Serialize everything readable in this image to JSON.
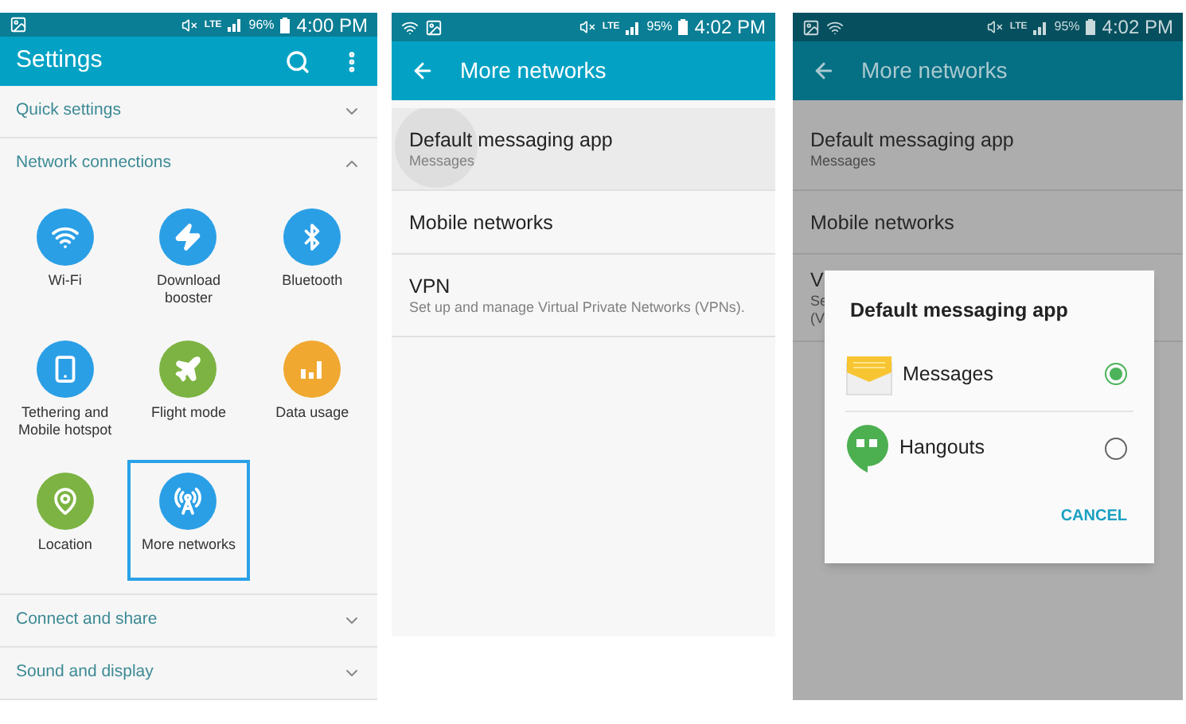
{
  "screens": [
    {
      "kind": "settings",
      "status_bar": {
        "icons": [
          {
            "kind": "image"
          }
        ],
        "network": "LTE",
        "battery": "96%",
        "time": "4:00 PM"
      },
      "title": "Settings",
      "sections": [
        {
          "label": "Quick settings",
          "expanded": false
        },
        {
          "label": "Network connections",
          "expanded": true,
          "items": [
            {
              "label": "Wi-Fi",
              "kind": "wifi",
              "color": "#2a9fe6",
              "selected": false
            },
            {
              "label": "Download booster",
              "kind": "booster",
              "color": "#2a9fe6",
              "selected": false
            },
            {
              "label": "Bluetooth",
              "kind": "bluetooth",
              "color": "#2a9fe6",
              "selected": false
            },
            {
              "label": "Tethering and Mobile hotspot",
              "kind": "tethering",
              "color": "#2a9fe6",
              "selected": false
            },
            {
              "label": "Flight mode",
              "kind": "flight",
              "color": "#7cb342",
              "selected": false
            },
            {
              "label": "Data usage",
              "kind": "data",
              "color": "#f0a830",
              "selected": false
            },
            {
              "label": "Location",
              "kind": "location",
              "color": "#7cb342",
              "selected": false
            },
            {
              "label": "More networks",
              "kind": "networks",
              "color": "#2a9fe6",
              "selected": true
            }
          ]
        },
        {
          "label": "Connect and share",
          "expanded": false
        },
        {
          "label": "Sound and display",
          "expanded": false
        }
      ]
    },
    {
      "kind": "list",
      "status_bar": {
        "icons": [
          {
            "kind": "wifi"
          },
          {
            "kind": "image"
          }
        ],
        "network": "LTE",
        "battery": "95%",
        "time": "4:02 PM"
      },
      "title": "More networks",
      "items": [
        {
          "title": "Default messaging app",
          "subtitle": "Messages",
          "pressed": true
        },
        {
          "title": "Mobile networks",
          "pressed": false
        },
        {
          "title": "VPN",
          "subtitle": "Set up and manage Virtual Private Networks (VPNs).",
          "pressed": false
        }
      ]
    },
    {
      "kind": "dialog",
      "status_bar": {
        "icons": [
          {
            "kind": "image"
          },
          {
            "kind": "wifi"
          }
        ],
        "network": "LTE",
        "battery": "95%",
        "time": "4:02 PM"
      },
      "title": "More networks",
      "items": [
        {
          "title": "Default messaging app",
          "subtitle": "Messages",
          "pressed": false
        },
        {
          "title": "Mobile networks",
          "pressed": false
        },
        {
          "title": "V",
          "subtitle": "Se",
          "subtitle_2": "(V",
          "pressed": false
        }
      ],
      "dialog": {
        "title": "Default messaging app",
        "options": [
          {
            "label": "Messages",
            "kind": "messages",
            "selected": true
          },
          {
            "label": "Hangouts",
            "kind": "hangouts",
            "selected": false
          }
        ],
        "button": "CANCEL"
      }
    }
  ]
}
